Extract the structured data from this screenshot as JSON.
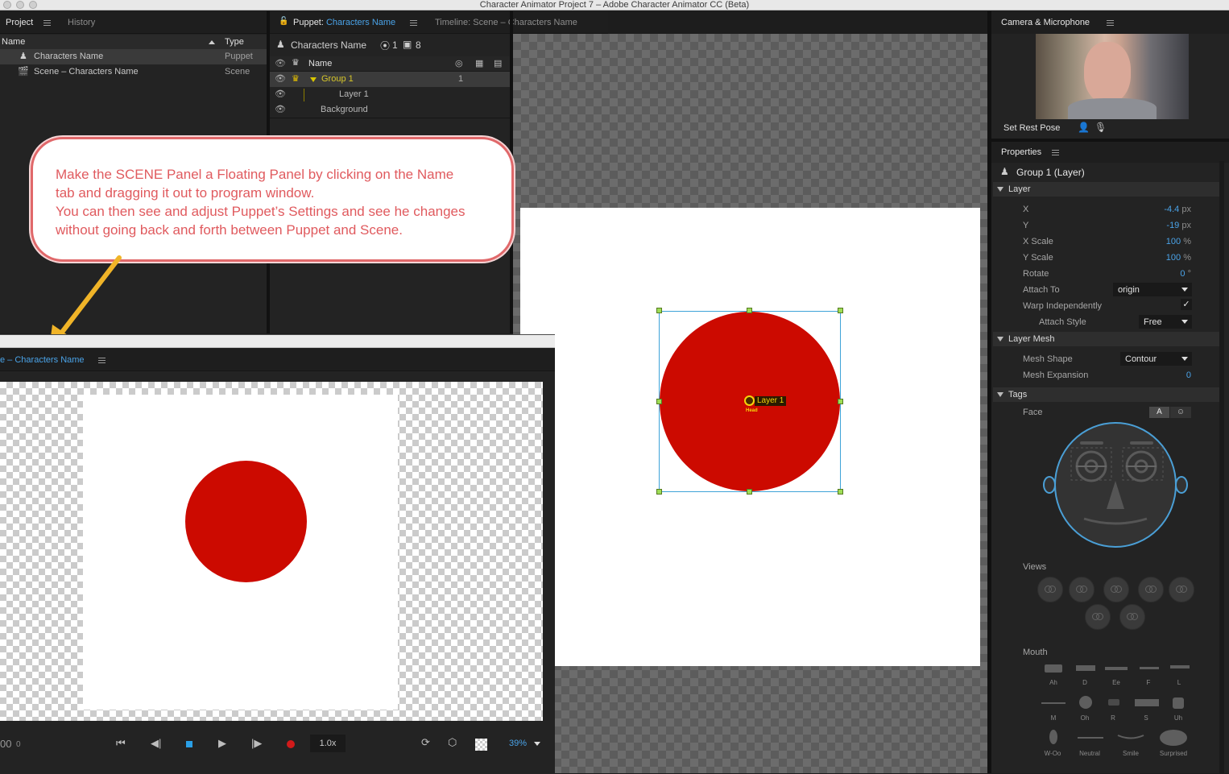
{
  "window_title": "Character Animator Project 7 – Adobe Character Animator CC (Beta)",
  "project_panel": {
    "tabs": [
      "Project",
      "History"
    ],
    "columns": [
      "Name",
      "Type"
    ],
    "rows": [
      {
        "name": "Characters Name",
        "type": "Puppet"
      },
      {
        "name": "Scene – Characters Name",
        "type": "Scene"
      }
    ]
  },
  "puppet_panel": {
    "tab_prefix": "Puppet:",
    "tab_name": "Characters Name",
    "timeline_tab": "Timeline: Scene – Characters Name",
    "puppet_name": "Characters Name",
    "count_a": "1",
    "count_b": "8",
    "column_name": "Name",
    "layers": [
      {
        "name": "Group 1",
        "value": "1"
      },
      {
        "name": "Layer 1",
        "value": ""
      },
      {
        "name": "Background",
        "value": ""
      }
    ]
  },
  "canvas": {
    "handle_label": "Layer 1",
    "handle_tag": "Head",
    "circle_color": "#cc0a00"
  },
  "callout": {
    "text_line1": "Make the SCENE Panel a Floating Panel by clicking on the Name",
    "text_line2": "tab and dragging it out to program window.",
    "text_line3": "You can then see and adjust Puppet’s Settings and see he changes",
    "text_line4": "without going back and forth between Puppet and Scene.",
    "arrow_color": "#f0b428"
  },
  "scene_panel": {
    "tab_prefix": "e – ",
    "tab_name": "Characters Name",
    "time": "00",
    "frame": "0",
    "speed": "1.0x",
    "zoom": "39%"
  },
  "camera_panel": {
    "title": "Camera & Microphone",
    "set_rest_pose": "Set Rest Pose"
  },
  "properties_panel": {
    "title": "Properties",
    "selection": "Group 1 (Layer)",
    "layer_section": "Layer",
    "x_label": "X",
    "x_value": "-4.4",
    "x_unit": "px",
    "y_label": "Y",
    "y_value": "-19",
    "y_unit": "px",
    "xscale_label": "X Scale",
    "xscale_value": "100",
    "xscale_unit": "%",
    "yscale_label": "Y Scale",
    "yscale_value": "100",
    "yscale_unit": "%",
    "rotate_label": "Rotate",
    "rotate_value": "0",
    "rotate_unit": "°",
    "attach_to_label": "Attach To",
    "attach_to_value": "origin",
    "warp_label": "Warp Independently",
    "warp_checked": true,
    "attach_style_label": "Attach Style",
    "attach_style_value": "Free",
    "mesh_section": "Layer Mesh",
    "mesh_shape_label": "Mesh Shape",
    "mesh_shape_value": "Contour",
    "mesh_expansion_label": "Mesh Expansion",
    "mesh_expansion_value": "0",
    "tags_section": "Tags",
    "face_label": "Face",
    "face_toggle_a": "A",
    "views_label": "Views",
    "mouth_label": "Mouth",
    "mouth_row1": [
      "Ah",
      "D",
      "Ee",
      "F",
      "L"
    ],
    "mouth_row2": [
      "M",
      "Oh",
      "R",
      "S",
      "Uh"
    ],
    "mouth_row3": [
      "W-Oo",
      "Neutral",
      "Smile",
      "Surprised"
    ]
  }
}
